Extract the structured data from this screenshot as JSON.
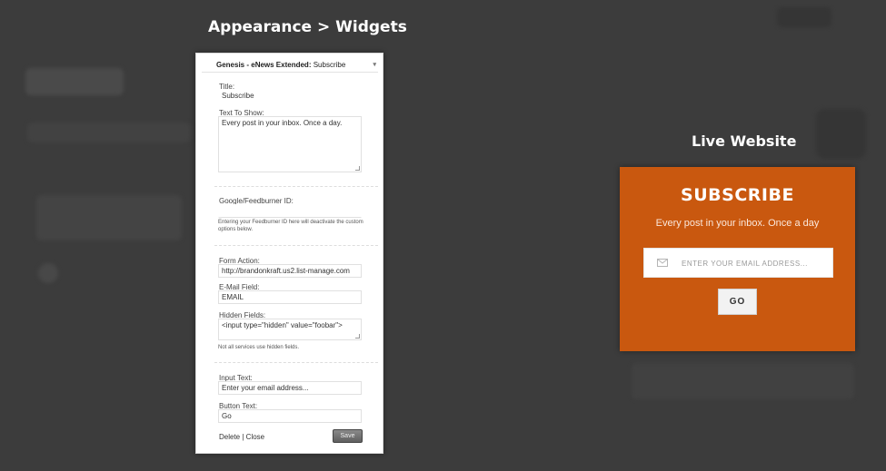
{
  "left_heading": "Appearance > Widgets",
  "right_heading": "Live Website",
  "widget": {
    "title": "Genesis - eNews Extended:",
    "subname": "Subscribe",
    "fields": {
      "title_label": "Title:",
      "title_value": "Subscribe",
      "text_label": "Text To Show:",
      "text_value": "Every post in your inbox. Once a day.",
      "feedburner_label": "Google/Feedburner ID:",
      "feedburner_note": "Entering your Feedburner ID here will deactivate the custom options below.",
      "form_action_label": "Form Action:",
      "form_action_value": "http://brandonkraft.us2.list-manage.com",
      "email_field_label": "E-Mail Field:",
      "email_field_value": "EMAIL",
      "hidden_fields_label": "Hidden Fields:",
      "hidden_fields_value": "<input type=\"hidden\" value=\"foobar\">",
      "hidden_note": "Not all services use hidden fields.",
      "input_text_label": "Input Text:",
      "input_text_value": "Enter your email address...",
      "button_text_label": "Button Text:",
      "button_text_value": "Go"
    },
    "delete_label": "Delete",
    "separator": "|",
    "close_label": "Close",
    "save_label": "Save"
  },
  "live": {
    "title": "SUBSCRIBE",
    "text": "Every post in your inbox. Once a day",
    "email_placeholder": "ENTER YOUR EMAIL ADDRESS...",
    "go_label": "GO"
  },
  "colors": {
    "background": "#3c3c3c",
    "live_box": "#c9580f"
  }
}
